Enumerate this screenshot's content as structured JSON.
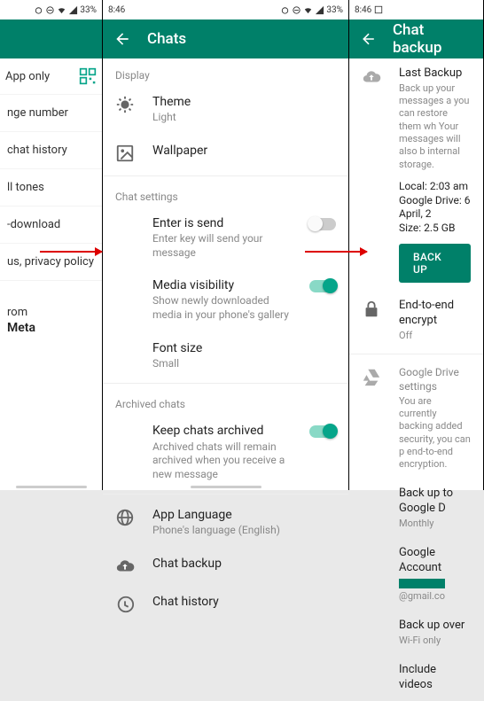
{
  "statusbar": {
    "time": "8:46",
    "battery": "33%"
  },
  "screen1": {
    "app_only": "App only",
    "items": [
      "nge number",
      "chat history",
      "ll tones",
      "-download",
      "us, privacy policy"
    ],
    "from": "rom",
    "meta": "Meta"
  },
  "screen2": {
    "title": "Chats",
    "sec_display": "Display",
    "theme": {
      "t": "Theme",
      "s": "Light"
    },
    "wallpaper": {
      "t": "Wallpaper"
    },
    "sec_settings": "Chat settings",
    "enter": {
      "t": "Enter is send",
      "s": "Enter key will send your message"
    },
    "media": {
      "t": "Media visibility",
      "s": "Show newly downloaded media in your phone's gallery"
    },
    "font": {
      "t": "Font size",
      "s": "Small"
    },
    "sec_archived": "Archived chats",
    "keep": {
      "t": "Keep chats archived",
      "s": "Archived chats will remain archived when you receive a new message"
    },
    "lang": {
      "t": "App Language",
      "s": "Phone's language (English)"
    },
    "backup": {
      "t": "Chat backup"
    },
    "history": {
      "t": "Chat history"
    }
  },
  "screen3": {
    "title": "Chat backup",
    "last": {
      "t": "Last Backup",
      "s": "Back up your messages a you can restore them wh Your messages will also b internal storage."
    },
    "local": "Local: 2:03 am",
    "drive": "Google Drive: 6 April, 2",
    "size": "Size: 2.5 GB",
    "btn": "BACK UP",
    "e2e": {
      "t": "End-to-end encrypt",
      "s": "Off"
    },
    "gdrive": {
      "t": "Google Drive settings",
      "s": "You are currently backing added security, you can p end-to-end encryption."
    },
    "buptogd": {
      "t": "Back up to Google D",
      "s": "Monthly"
    },
    "account": {
      "t": "Google Account",
      "s": "@gmail.co"
    },
    "over": {
      "t": "Back up over",
      "s": "Wi-Fi only"
    },
    "videos": {
      "t": "Include videos"
    }
  }
}
